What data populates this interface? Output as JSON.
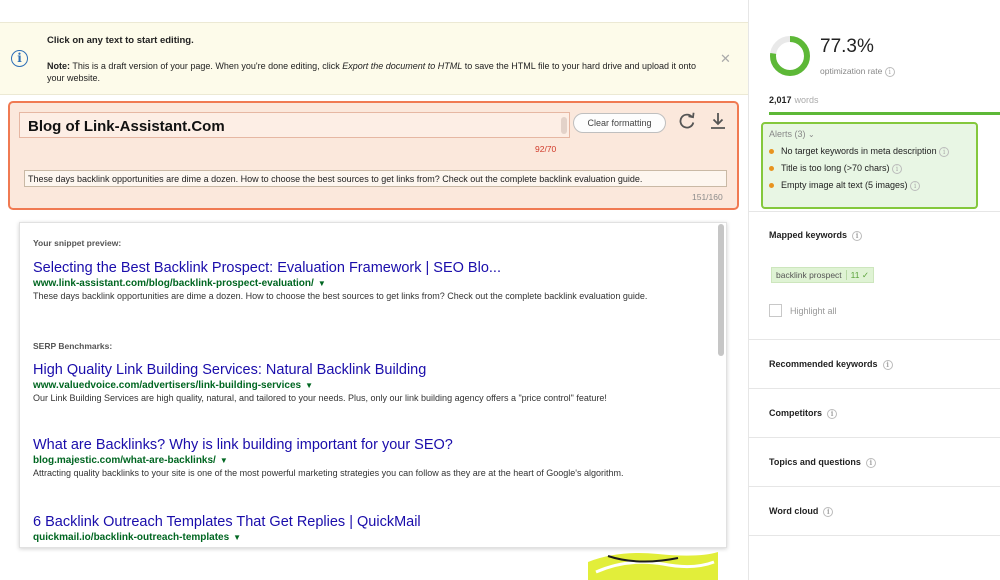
{
  "notice": {
    "title": "Click on any text to start editing.",
    "note_label": "Note:",
    "text_before": " This is a draft version of your page. When you're done editing, click ",
    "export_action": "Export the document to HTML",
    "text_after": " to save the HTML file to your hard drive and upload it onto your website."
  },
  "editor": {
    "title": "Blog of Link-Assistant.Com",
    "title_counter": "92/70",
    "clear_button": "Clear formatting",
    "description": "These days backlink opportunities are dime a dozen. How to choose the best sources to get links from? Check out the complete backlink evaluation guide.",
    "description_counter": "151/160"
  },
  "snippet": {
    "preview_label": "Your snippet preview:",
    "preview": {
      "title": "Selecting the Best Backlink Prospect: Evaluation Framework | SEO Blo...",
      "url": "www.link-assistant.com/blog/backlink-prospect-evaluation/",
      "desc": "These days backlink opportunities are dime a dozen. How to choose the best sources to get links from? Check out the complete backlink evaluation guide."
    },
    "benchmarks_label": "SERP Benchmarks:",
    "benchmarks": [
      {
        "title": "High Quality Link Building Services: Natural Backlink Building",
        "url": "www.valuedvoice.com/advertisers/link-building-services",
        "desc": "Our Link Building Services are high quality, natural, and tailored to your needs. Plus, only our link building agency offers a \"price control\" feature!"
      },
      {
        "title": "What are Backlinks? Why is link building important for your SEO?",
        "url": "blog.majestic.com/what-are-backlinks/",
        "desc": "Attracting quality backlinks to your site is one of the most powerful marketing strategies you can follow as they are at the heart of Google's algorithm."
      },
      {
        "title": "6 Backlink Outreach Templates That Get Replies | QuickMail",
        "url": "quickmail.io/backlink-outreach-templates",
        "desc": ""
      }
    ]
  },
  "sidebar": {
    "optimization_rate": "77.3%",
    "optimization_rate_value": 0.773,
    "optimization_label": "optimization rate",
    "word_count": "2,017",
    "word_label": "words",
    "alerts_header": "Alerts (3)",
    "alerts": [
      "No target keywords in meta description",
      "Title is too long (>70 chars)",
      "Empty image alt text (5 images)"
    ],
    "mapped_keywords": "Mapped keywords",
    "keyword_chip": "backlink prospect",
    "keyword_count": "11",
    "highlight_all": "Highlight all",
    "recommended_keywords": "Recommended keywords",
    "competitors": "Competitors",
    "topics": "Topics and questions",
    "word_cloud": "Word cloud"
  },
  "colors": {
    "accent_green": "#5db837",
    "alert_orange": "#f07a52",
    "link_blue": "#1a0dab",
    "url_green": "#006621"
  },
  "icons": [
    "info-icon",
    "close-icon",
    "refresh-icon",
    "download-icon",
    "chevron-down-icon",
    "checkmark-icon"
  ]
}
